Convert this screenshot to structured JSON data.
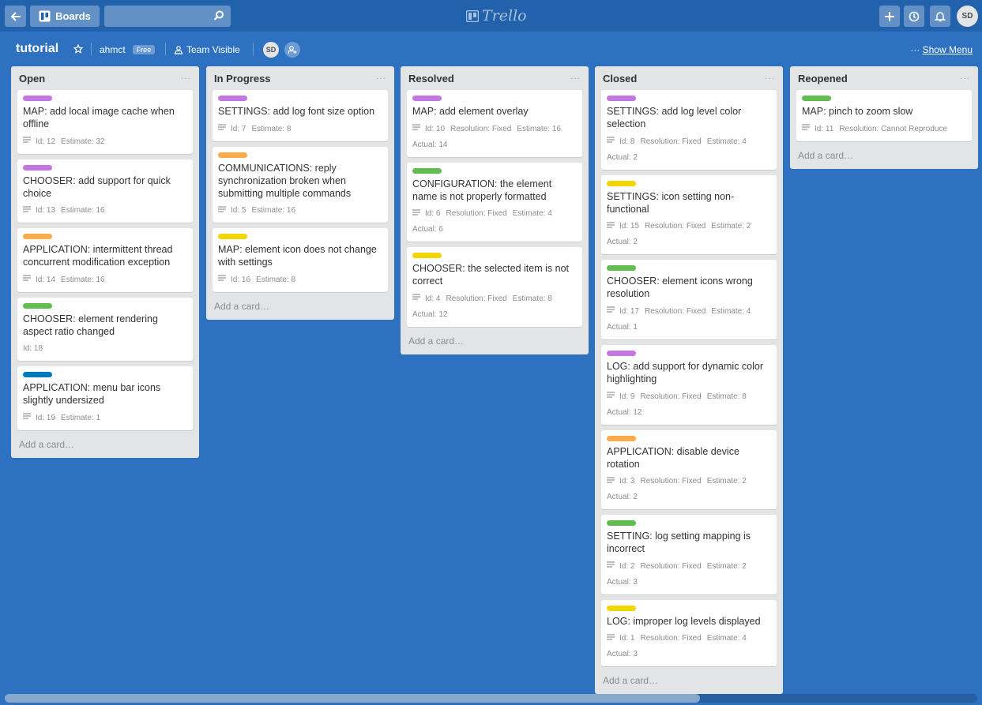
{
  "colors": {
    "purple": "#c377e0",
    "orange": "#ffab4a",
    "green": "#61bd4f",
    "yellow": "#f2d600",
    "blue": "#0079bf"
  },
  "header": {
    "boards_label": "Boards",
    "logo_text": "Trello",
    "avatar_initials": "SD",
    "icons": [
      "back-icon",
      "boards-icon",
      "search-icon",
      "plus-icon",
      "info-icon",
      "bell-icon"
    ]
  },
  "board": {
    "title": "tutorial",
    "org": "ahmct",
    "plan_badge": "Free",
    "visibility": "Team Visible",
    "member_initials": "SD",
    "show_menu_dots": "···",
    "show_menu": "Show Menu"
  },
  "lists": [
    {
      "name": "Open",
      "menu": "···",
      "add_card": "Add a card…",
      "cards": [
        {
          "label": "purple",
          "title": "MAP: add local image cache when offline",
          "desc": true,
          "badges": [
            "Id: 12",
            "Estimate: 32"
          ]
        },
        {
          "label": "purple",
          "title": "CHOOSER: add support for quick choice",
          "desc": true,
          "badges": [
            "Id: 13",
            "Estimate: 16"
          ]
        },
        {
          "label": "orange",
          "title": "APPLICATION: intermittent thread concurrent modification exception",
          "desc": true,
          "badges": [
            "Id: 14",
            "Estimate: 16"
          ]
        },
        {
          "label": "green",
          "title": "CHOOSER: element rendering aspect ratio changed",
          "desc": false,
          "badges": [
            "Id: 18"
          ]
        },
        {
          "label": "blue",
          "title": "APPLICATION: menu bar icons slightly undersized",
          "desc": true,
          "badges": [
            "Id: 19",
            "Estimate: 1"
          ]
        }
      ]
    },
    {
      "name": "In Progress",
      "menu": "···",
      "add_card": "Add a card…",
      "cards": [
        {
          "label": "purple",
          "title": "SETTINGS: add log font size option",
          "desc": true,
          "badges": [
            "Id: 7",
            "Estimate: 8"
          ]
        },
        {
          "label": "orange",
          "title": "COMMUNICATIONS: reply synchronization broken when submitting multiple commands",
          "desc": true,
          "badges": [
            "Id: 5",
            "Estimate: 16"
          ]
        },
        {
          "label": "yellow",
          "title": "MAP: element icon does not change with settings",
          "desc": true,
          "badges": [
            "Id: 16",
            "Estimate: 8"
          ]
        }
      ]
    },
    {
      "name": "Resolved",
      "menu": "···",
      "add_card": "Add a card…",
      "cards": [
        {
          "label": "purple",
          "title": "MAP: add element overlay",
          "desc": true,
          "badges": [
            "Id: 10",
            "Resolution: Fixed",
            "Estimate: 16",
            "Actual: 14"
          ]
        },
        {
          "label": "green",
          "title": "CONFIGURATION: the element name is not properly formatted",
          "desc": true,
          "badges": [
            "Id: 6",
            "Resolution: Fixed",
            "Estimate: 4",
            "Actual: 6"
          ]
        },
        {
          "label": "yellow",
          "title": "CHOOSER: the selected item is not correct",
          "desc": true,
          "badges": [
            "Id: 4",
            "Resolution: Fixed",
            "Estimate: 8",
            "Actual: 12"
          ]
        }
      ]
    },
    {
      "name": "Closed",
      "menu": "···",
      "add_card": "Add a card…",
      "cards": [
        {
          "label": "purple",
          "title": "SETTINGS: add log level color selection",
          "desc": true,
          "badges": [
            "Id: 8",
            "Resolution: Fixed",
            "Estimate: 4",
            "Actual: 2"
          ]
        },
        {
          "label": "yellow",
          "title": "SETTINGS: icon setting non-functional",
          "desc": true,
          "badges": [
            "Id: 15",
            "Resolution: Fixed",
            "Estimate: 2",
            "Actual: 2"
          ]
        },
        {
          "label": "green",
          "title": "CHOOSER: element icons wrong resolution",
          "desc": true,
          "badges": [
            "Id: 17",
            "Resolution: Fixed",
            "Estimate: 4",
            "Actual: 1"
          ]
        },
        {
          "label": "purple",
          "title": "LOG: add support for dynamic color highlighting",
          "desc": true,
          "badges": [
            "Id: 9",
            "Resolution: Fixed",
            "Estimate: 8",
            "Actual: 12"
          ]
        },
        {
          "label": "orange",
          "title": "APPLICATION: disable device rotation",
          "desc": true,
          "badges": [
            "Id: 3",
            "Resolution: Fixed",
            "Estimate: 2",
            "Actual: 2"
          ]
        },
        {
          "label": "green",
          "title": "SETTING: log setting mapping is incorrect",
          "desc": true,
          "badges": [
            "Id: 2",
            "Resolution: Fixed",
            "Estimate: 2",
            "Actual: 3"
          ]
        },
        {
          "label": "yellow",
          "title": "LOG: improper log levels displayed",
          "desc": true,
          "badges": [
            "Id: 1",
            "Resolution: Fixed",
            "Estimate: 4",
            "Actual: 3"
          ]
        }
      ]
    },
    {
      "name": "Reopened",
      "menu": "···",
      "add_card": "Add a card…",
      "cards": [
        {
          "label": "green",
          "title": "MAP: pinch to zoom slow",
          "desc": true,
          "badges": [
            "Id: 11",
            "Resolution: Cannot Reproduce"
          ]
        }
      ]
    }
  ]
}
